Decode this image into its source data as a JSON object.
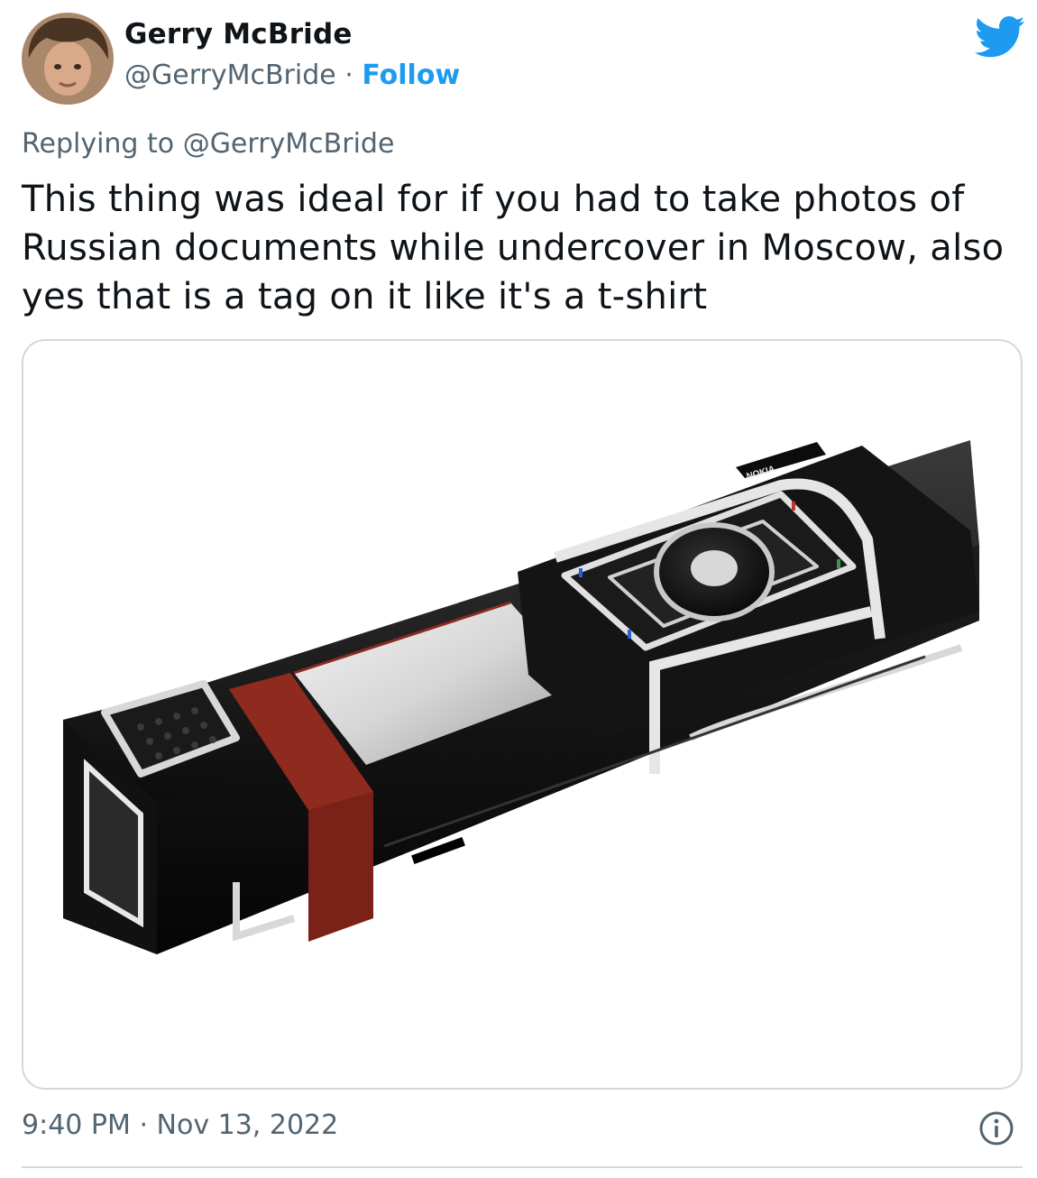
{
  "author": {
    "name": "Gerry McBride",
    "handle": "@GerryMcBride",
    "separator": "·",
    "follow_label": "Follow"
  },
  "reply": {
    "prefix": "Replying to",
    "mention": "@GerryMcBride"
  },
  "tweet": {
    "text": "This thing was ideal for if you had to take photos of Russian documents while undercover in Moscow, also yes that is a tag on it like it's a t-shirt"
  },
  "media": {
    "brand_label": "NOKIA"
  },
  "meta": {
    "time": "9:40 PM",
    "separator": "·",
    "date": "Nov 13, 2022"
  },
  "icons": {
    "logo": "twitter-bird-icon",
    "info": "info-circle-icon"
  },
  "colors": {
    "text": "#0f1419",
    "secondary": "#536471",
    "accent": "#1d9bf0",
    "border": "#cfd9de"
  }
}
